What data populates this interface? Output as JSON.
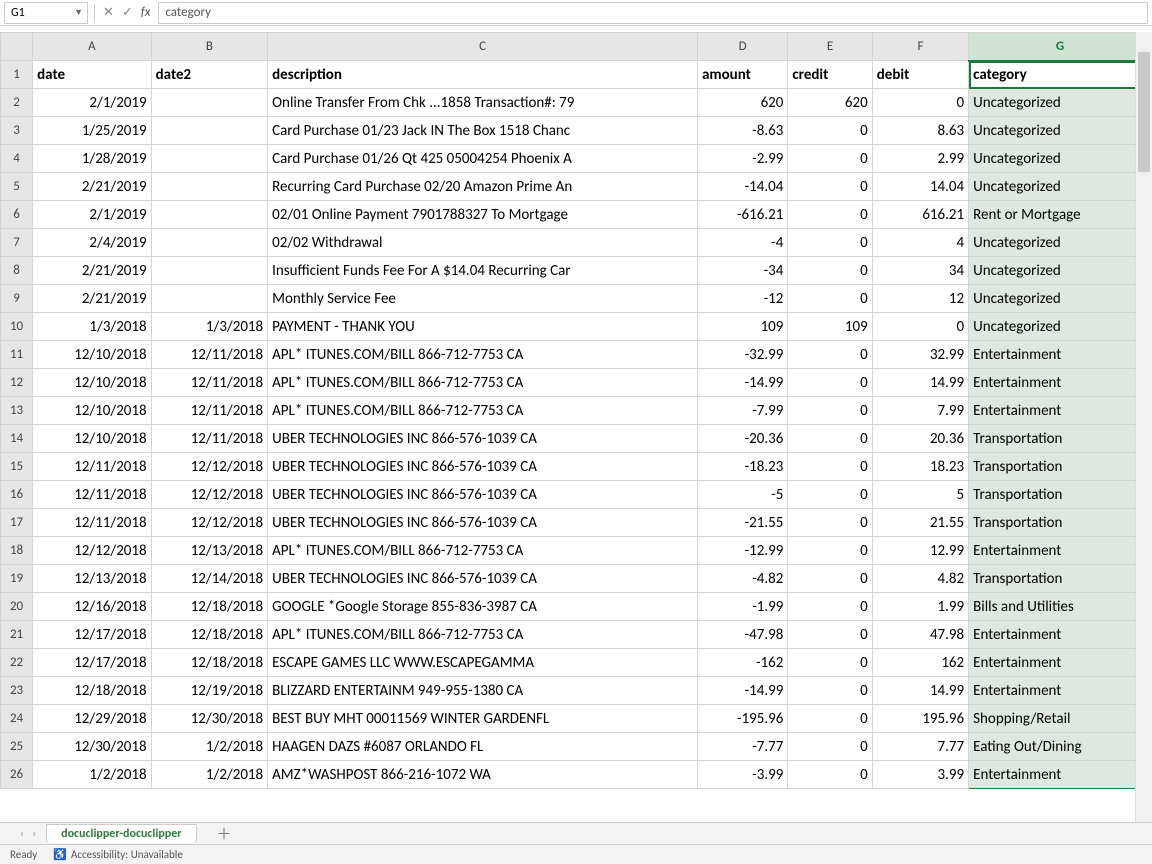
{
  "formula_bar": {
    "name_box": "G1",
    "formula": "category"
  },
  "columns": [
    "A",
    "B",
    "C",
    "D",
    "E",
    "F",
    "G"
  ],
  "selected_column_index": 6,
  "headers": {
    "A": "date",
    "B": "date2",
    "C": "description",
    "D": "amount",
    "E": "credit",
    "F": "debit",
    "G": "category"
  },
  "rows": [
    {
      "n": 2,
      "date": "2/1/2019",
      "date2": "",
      "desc": "Online Transfer From Chk ...1858 Transaction#: 79",
      "amount": "620",
      "credit": "620",
      "debit": "0",
      "cat": "Uncategorized"
    },
    {
      "n": 3,
      "date": "1/25/2019",
      "date2": "",
      "desc": "Card Purchase 01/23 Jack IN The Box 1518 Chanc",
      "amount": "-8.63",
      "credit": "0",
      "debit": "8.63",
      "cat": "Uncategorized"
    },
    {
      "n": 4,
      "date": "1/28/2019",
      "date2": "",
      "desc": "Card Purchase 01/26 Qt 425 05004254 Phoenix A",
      "amount": "-2.99",
      "credit": "0",
      "debit": "2.99",
      "cat": "Uncategorized"
    },
    {
      "n": 5,
      "date": "2/21/2019",
      "date2": "",
      "desc": "Recurring Card Purchase 02/20 Amazon Prime An",
      "amount": "-14.04",
      "credit": "0",
      "debit": "14.04",
      "cat": "Uncategorized"
    },
    {
      "n": 6,
      "date": "2/1/2019",
      "date2": "",
      "desc": "02/01 Online Payment 7901788327 To Mortgage",
      "amount": "-616.21",
      "credit": "0",
      "debit": "616.21",
      "cat": "Rent or Mortgage"
    },
    {
      "n": 7,
      "date": "2/4/2019",
      "date2": "",
      "desc": "02/02 Withdrawal",
      "amount": "-4",
      "credit": "0",
      "debit": "4",
      "cat": "Uncategorized"
    },
    {
      "n": 8,
      "date": "2/21/2019",
      "date2": "",
      "desc": "Insufficient Funds Fee For A $14.04 Recurring Car",
      "amount": "-34",
      "credit": "0",
      "debit": "34",
      "cat": "Uncategorized"
    },
    {
      "n": 9,
      "date": "2/21/2019",
      "date2": "",
      "desc": "Monthly Service Fee",
      "amount": "-12",
      "credit": "0",
      "debit": "12",
      "cat": "Uncategorized"
    },
    {
      "n": 10,
      "date": "1/3/2018",
      "date2": "1/3/2018",
      "desc": "PAYMENT - THANK YOU",
      "amount": "109",
      "credit": "109",
      "debit": "0",
      "cat": "Uncategorized"
    },
    {
      "n": 11,
      "date": "12/10/2018",
      "date2": "12/11/2018",
      "desc": "APL* ITUNES.COM/BILL 866-712-7753 CA",
      "amount": "-32.99",
      "credit": "0",
      "debit": "32.99",
      "cat": "Entertainment"
    },
    {
      "n": 12,
      "date": "12/10/2018",
      "date2": "12/11/2018",
      "desc": "APL* ITUNES.COM/BILL 866-712-7753 CA",
      "amount": "-14.99",
      "credit": "0",
      "debit": "14.99",
      "cat": "Entertainment"
    },
    {
      "n": 13,
      "date": "12/10/2018",
      "date2": "12/11/2018",
      "desc": "APL* ITUNES.COM/BILL 866-712-7753 CA",
      "amount": "-7.99",
      "credit": "0",
      "debit": "7.99",
      "cat": "Entertainment"
    },
    {
      "n": 14,
      "date": "12/10/2018",
      "date2": "12/11/2018",
      "desc": "UBER TECHNOLOGIES INC 866-576-1039 CA",
      "amount": "-20.36",
      "credit": "0",
      "debit": "20.36",
      "cat": "Transportation"
    },
    {
      "n": 15,
      "date": "12/11/2018",
      "date2": "12/12/2018",
      "desc": "UBER TECHNOLOGIES INC 866-576-1039 CA",
      "amount": "-18.23",
      "credit": "0",
      "debit": "18.23",
      "cat": "Transportation"
    },
    {
      "n": 16,
      "date": "12/11/2018",
      "date2": "12/12/2018",
      "desc": "UBER TECHNOLOGIES INC 866-576-1039 CA",
      "amount": "-5",
      "credit": "0",
      "debit": "5",
      "cat": "Transportation"
    },
    {
      "n": 17,
      "date": "12/11/2018",
      "date2": "12/12/2018",
      "desc": "UBER TECHNOLOGIES INC 866-576-1039 CA",
      "amount": "-21.55",
      "credit": "0",
      "debit": "21.55",
      "cat": "Transportation"
    },
    {
      "n": 18,
      "date": "12/12/2018",
      "date2": "12/13/2018",
      "desc": "APL* ITUNES.COM/BILL 866-712-7753 CA",
      "amount": "-12.99",
      "credit": "0",
      "debit": "12.99",
      "cat": "Entertainment"
    },
    {
      "n": 19,
      "date": "12/13/2018",
      "date2": "12/14/2018",
      "desc": "UBER TECHNOLOGIES INC 866-576-1039 CA",
      "amount": "-4.82",
      "credit": "0",
      "debit": "4.82",
      "cat": "Transportation"
    },
    {
      "n": 20,
      "date": "12/16/2018",
      "date2": "12/18/2018",
      "desc": "GOOGLE *Google Storage 855-836-3987 CA",
      "amount": "-1.99",
      "credit": "0",
      "debit": "1.99",
      "cat": "Bills and Utilities"
    },
    {
      "n": 21,
      "date": "12/17/2018",
      "date2": "12/18/2018",
      "desc": "APL* ITUNES.COM/BILL 866-712-7753 CA",
      "amount": "-47.98",
      "credit": "0",
      "debit": "47.98",
      "cat": "Entertainment"
    },
    {
      "n": 22,
      "date": "12/17/2018",
      "date2": "12/18/2018",
      "desc": "ESCAPE GAMES LLC WWW.ESCAPEGAMMA",
      "amount": "-162",
      "credit": "0",
      "debit": "162",
      "cat": "Entertainment"
    },
    {
      "n": 23,
      "date": "12/18/2018",
      "date2": "12/19/2018",
      "desc": "BLIZZARD ENTERTAINM 949-955-1380 CA",
      "amount": "-14.99",
      "credit": "0",
      "debit": "14.99",
      "cat": "Entertainment"
    },
    {
      "n": 24,
      "date": "12/29/2018",
      "date2": "12/30/2018",
      "desc": "BEST BUY MHT 00011569 WINTER GARDENFL",
      "amount": "-195.96",
      "credit": "0",
      "debit": "195.96",
      "cat": "Shopping/Retail"
    },
    {
      "n": 25,
      "date": "12/30/2018",
      "date2": "1/2/2018",
      "desc": "HAAGEN DAZS #6087 ORLANDO FL",
      "amount": "-7.77",
      "credit": "0",
      "debit": "7.77",
      "cat": "Eating Out/Dining"
    },
    {
      "n": 26,
      "date": "1/2/2018",
      "date2": "1/2/2018",
      "desc": "AMZ*WASHPOST 866-216-1072 WA",
      "amount": "-3.99",
      "credit": "0",
      "debit": "3.99",
      "cat": "Entertainment"
    }
  ],
  "tabs": {
    "active": "docuclipper-docuclipper"
  },
  "status": {
    "ready": "Ready",
    "accessibility": "Accessibility: Unavailable"
  }
}
